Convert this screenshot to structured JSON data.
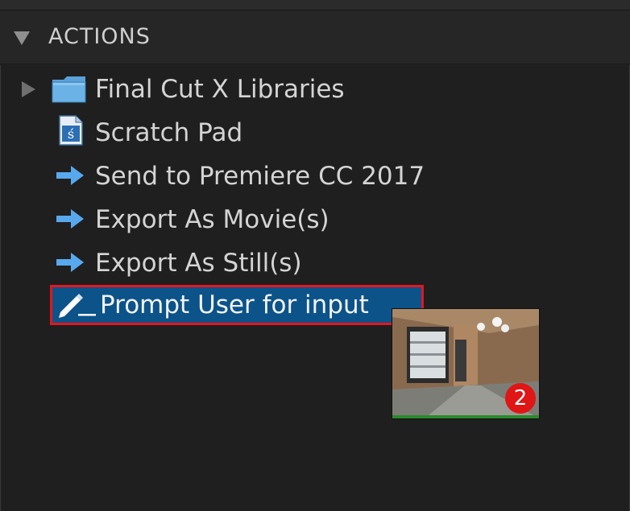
{
  "panel": {
    "section_title": "ACTIONS",
    "items": [
      {
        "label": "Final Cut X Libraries",
        "icon": "folder-icon",
        "expandable": true
      },
      {
        "label": "Scratch Pad",
        "icon": "scratch-pad-document-icon"
      },
      {
        "label": "Send to Premiere CC 2017",
        "icon": "arrow-right-icon"
      },
      {
        "label": "Export As Movie(s)",
        "icon": "arrow-right-icon"
      },
      {
        "label": "Export As Still(s)",
        "icon": "arrow-right-icon"
      },
      {
        "label": "Prompt User for input",
        "icon": "pencil-icon",
        "selected": true
      }
    ]
  },
  "drag_preview": {
    "badge_count": "2"
  },
  "colors": {
    "background": "#1f1f1f",
    "selection": "#0b5389",
    "highlight_border": "#e4161f",
    "icon_blue": "#4f9de6",
    "badge": "#e01515"
  }
}
